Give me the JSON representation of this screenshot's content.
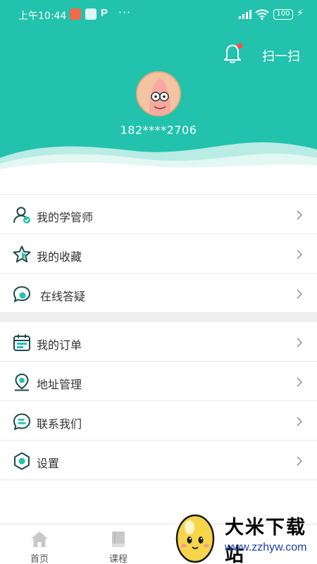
{
  "status_bar": {
    "time": "上午10:44",
    "battery": "100",
    "dots": "···"
  },
  "header": {
    "scan_label": "扫一扫",
    "phone": "182****2706"
  },
  "menu_group_1": [
    {
      "label": "我的学管师",
      "icon": "tutor-user-icon"
    },
    {
      "label": "我的收藏",
      "icon": "star-icon"
    },
    {
      "label": "在线答疑",
      "icon": "chat-question-icon"
    }
  ],
  "menu_group_2": [
    {
      "label": "我的订单",
      "icon": "order-calendar-icon"
    },
    {
      "label": "地址管理",
      "icon": "location-icon"
    },
    {
      "label": "联系我们",
      "icon": "contact-chat-icon"
    },
    {
      "label": "设置",
      "icon": "settings-hexagon-icon"
    }
  ],
  "tabbar": {
    "home": "首页",
    "course": "课程"
  },
  "watermark": {
    "title": "大米下载站",
    "url": "www.zzhyw.com"
  },
  "colors": {
    "accent": "#22c2ad",
    "icon_dark": "#1e4a4a",
    "notification_dot": "#ff4d4d"
  }
}
